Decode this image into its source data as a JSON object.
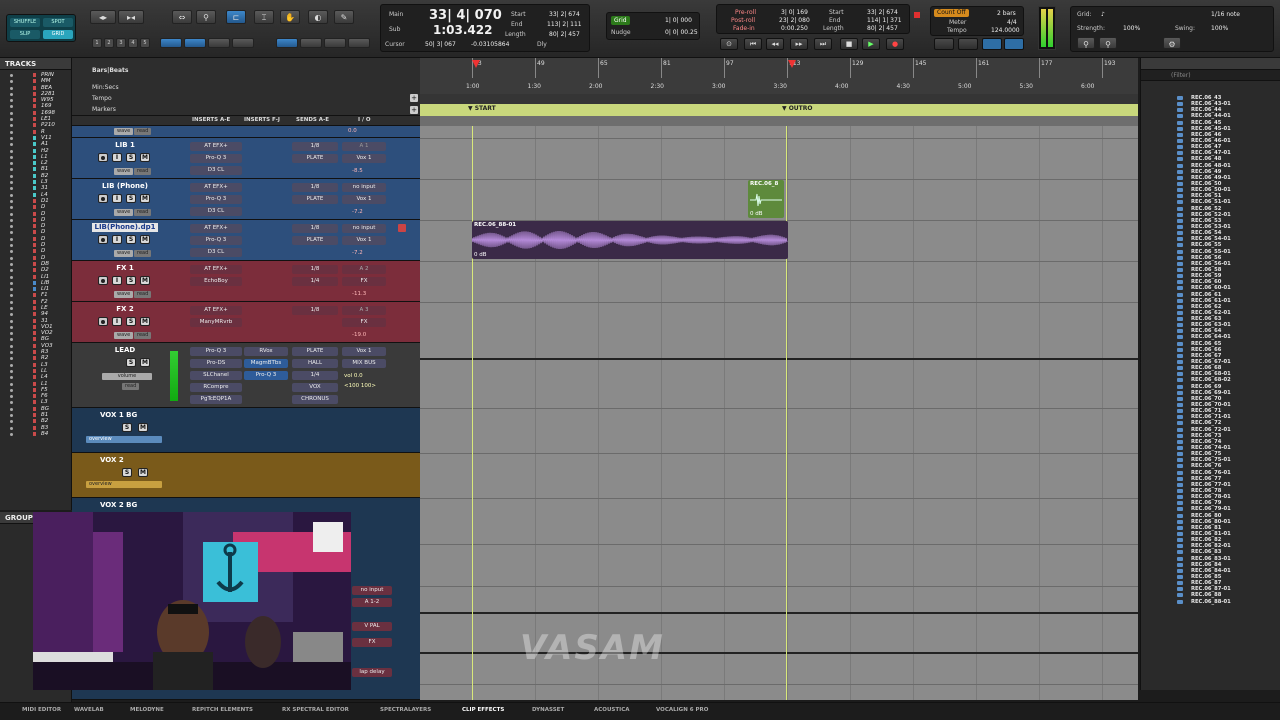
{
  "toolbar": {
    "modes": [
      "SHUFFLE",
      "SPOT",
      "SLIP",
      "GRID"
    ],
    "zoom_presets": [
      "1",
      "2",
      "3",
      "4",
      "5"
    ],
    "counter": {
      "main_label": "Main",
      "main_value": "33| 4| 070",
      "sub_label": "Sub",
      "sub_value": "1:03.422",
      "cursor_label": "Cursor",
      "cursor_value": "50| 3| 067",
      "cursor_value2": "-0.03105864",
      "start_label": "Start",
      "end_label": "End",
      "length_label": "Length",
      "start_value": "33| 2| 674",
      "end_value": "113| 2| 111",
      "length_value": "80| 2| 457",
      "dly_label": "Dly"
    },
    "grid": {
      "label": "Grid",
      "value": "1| 0| 000",
      "nudge_label": "Nudge",
      "nudge_value": "0| 0| 00.25"
    },
    "preroll": {
      "preroll_label": "Pre-roll",
      "postroll_label": "Post-roll",
      "fadein_label": "Fade-in",
      "preroll_value": "3| 0| 169",
      "postroll_value": "23| 2| 080",
      "fadein_value": "0:00.250",
      "start_label": "Start",
      "end_label": "End",
      "length_label": "Length",
      "start_value": "33| 2| 674",
      "end_value": "114| 1| 371",
      "length_value": "80| 2| 457"
    },
    "countoff": {
      "label": "Count Off",
      "bars": "2 bars",
      "meter_label": "Meter",
      "meter_value": "4/4",
      "tempo_label": "Tempo",
      "tempo_value": "124.0000"
    },
    "grid_panel": {
      "grid_label": "Grid:",
      "grid_value": "1/16 note",
      "strength_label": "Strength:",
      "strength_value": "100%",
      "swing_label": "Swing:",
      "swing_value": "100%"
    }
  },
  "tracks_panel": {
    "title": "TRACKS",
    "items": [
      {
        "name": "PRIN",
        "color": "#c94a4a"
      },
      {
        "name": "MM",
        "color": "#c94a4a"
      },
      {
        "name": "BEA",
        "color": "#c94a4a"
      },
      {
        "name": "2281",
        "color": "#c94a4a"
      },
      {
        "name": "W95",
        "color": "#c94a4a"
      },
      {
        "name": "169",
        "color": "#c94a4a"
      },
      {
        "name": "1698",
        "color": "#c94a4a"
      },
      {
        "name": "LE1",
        "color": "#c94a4a"
      },
      {
        "name": "P210",
        "color": "#c94a4a"
      },
      {
        "name": "R",
        "color": "#c94a4a"
      },
      {
        "name": "V11",
        "color": "#4ac9c9"
      },
      {
        "name": "A1",
        "color": "#4ac9c9"
      },
      {
        "name": "H2",
        "color": "#4ac9c9"
      },
      {
        "name": "L1",
        "color": "#4ac9c9"
      },
      {
        "name": "L2",
        "color": "#4ac9c9"
      },
      {
        "name": "B1",
        "color": "#4ac9c9"
      },
      {
        "name": "B2",
        "color": "#4ac9c9"
      },
      {
        "name": "L3",
        "color": "#4ac9c9"
      },
      {
        "name": "31",
        "color": "#4ac9c9"
      },
      {
        "name": "L4",
        "color": "#4ac9c9"
      },
      {
        "name": "D1",
        "color": "#c94a4a"
      },
      {
        "name": "D",
        "color": "#c94a4a"
      },
      {
        "name": "D",
        "color": "#c94a4a"
      },
      {
        "name": "D",
        "color": "#c94a4a"
      },
      {
        "name": "D",
        "color": "#c94a4a"
      },
      {
        "name": "D",
        "color": "#c94a4a"
      },
      {
        "name": "D",
        "color": "#c94a4a"
      },
      {
        "name": "D",
        "color": "#c94a4a"
      },
      {
        "name": "D",
        "color": "#c94a4a"
      },
      {
        "name": "D",
        "color": "#c94a4a"
      },
      {
        "name": "DB",
        "color": "#c94a4a"
      },
      {
        "name": "D2",
        "color": "#c94a4a"
      },
      {
        "name": "LI1",
        "color": "#c94a4a"
      },
      {
        "name": "LIB",
        "color": "#4a8ac9"
      },
      {
        "name": "LI1",
        "color": "#4a8ac9"
      },
      {
        "name": "F1",
        "color": "#c94a4a"
      },
      {
        "name": "F2",
        "color": "#c94a4a"
      },
      {
        "name": "LE",
        "color": "#c94a4a"
      },
      {
        "name": "94",
        "color": "#c94a4a"
      },
      {
        "name": "31",
        "color": "#c94a4a"
      },
      {
        "name": "VO1",
        "color": "#c94a4a"
      },
      {
        "name": "VO2",
        "color": "#c94a4a"
      },
      {
        "name": "BG",
        "color": "#c94a4a"
      },
      {
        "name": "VO3",
        "color": "#c94a4a"
      },
      {
        "name": "R3",
        "color": "#c94a4a"
      },
      {
        "name": "R2",
        "color": "#c94a4a"
      },
      {
        "name": "L3",
        "color": "#c94a4a"
      },
      {
        "name": "LL",
        "color": "#c94a4a"
      },
      {
        "name": "L4",
        "color": "#c94a4a"
      },
      {
        "name": "L1",
        "color": "#c94a4a"
      },
      {
        "name": "F5",
        "color": "#c94a4a"
      },
      {
        "name": "F6",
        "color": "#c94a4a"
      },
      {
        "name": "L3",
        "color": "#c94a4a"
      },
      {
        "name": "BG",
        "color": "#c94a4a"
      },
      {
        "name": "B1",
        "color": "#c94a4a"
      },
      {
        "name": "B2",
        "color": "#c94a4a"
      },
      {
        "name": "B3",
        "color": "#c94a4a"
      },
      {
        "name": "B4",
        "color": "#c94a4a"
      }
    ]
  },
  "group_panel": {
    "title": "GROUP"
  },
  "rulers": {
    "labels": [
      "Bars|Beats",
      "Min:Secs",
      "Tempo",
      "Markers"
    ],
    "bars": [
      "33",
      "49",
      "65",
      "81",
      "97",
      "113",
      "129",
      "145",
      "161",
      "177",
      "193"
    ],
    "times": [
      "1:00",
      "1:30",
      "2:00",
      "2:30",
      "3:00",
      "3:30",
      "4:00",
      "4:30",
      "5:00",
      "5:30",
      "6:00"
    ],
    "markers": [
      {
        "name": "START"
      },
      {
        "name": "OUTRO"
      }
    ]
  },
  "columns": {
    "inserts_ae": "INSERTS A-E",
    "inserts_fj": "INSERTS F-J",
    "sends_ae": "SENDS A-E",
    "io": "I / O"
  },
  "tracks": [
    {
      "name": "",
      "view": "wave",
      "view2": "read",
      "insert1": "",
      "send_vol": "0.0",
      "io_in": "",
      "io_out": "",
      "vol": "",
      "color": "#2d4f7c"
    },
    {
      "name": "LIB 1",
      "view": "wave",
      "view2": "read",
      "inserts": [
        "AT EFX+",
        "Pro-Q 3",
        "D3 CL"
      ],
      "sends": [
        "1/8",
        "PLATE",
        ""
      ],
      "io": [
        "A 1",
        "Vox 1",
        "-8.5"
      ],
      "color": "#2d4f7c"
    },
    {
      "name": "LIB (Phone)",
      "view": "wave",
      "view2": "read",
      "inserts": [
        "AT EFX+",
        "Pro-Q 3",
        "D3 CL"
      ],
      "sends": [
        "1/8",
        "PLATE",
        ""
      ],
      "io": [
        "no input",
        "Vox 1",
        "-7.2"
      ],
      "color": "#2d4f7c"
    },
    {
      "name": "LIB(Phone).dp1",
      "view": "wave",
      "view2": "read",
      "inserts": [
        "AT EFX+",
        "Pro-Q 3",
        "D3 CL"
      ],
      "sends": [
        "1/8",
        "PLATE",
        ""
      ],
      "io": [
        "no input",
        "Vox 1",
        "-7.2"
      ],
      "color": "#2d4f7c"
    },
    {
      "name": "FX 1",
      "view": "wave",
      "view2": "read",
      "inserts": [
        "AT EFX+",
        "EchoBoy",
        ""
      ],
      "sends": [
        "1/8",
        "1/4",
        ""
      ],
      "io": [
        "A 2",
        "FX",
        "-11.3"
      ],
      "color": "#7c2d3b"
    },
    {
      "name": "FX 2",
      "view": "wave",
      "view2": "read",
      "inserts": [
        "AT EFX+",
        "ManyMRvrb",
        ""
      ],
      "sends": [
        "1/8",
        "",
        ""
      ],
      "io": [
        "A 3",
        "FX",
        "-19.0"
      ],
      "color": "#7c2d3b"
    },
    {
      "name": "LEAD",
      "view": "volume",
      "view2": "read",
      "inserts": [
        "Pro-Q 3",
        "Pro-DS",
        "SLChanel",
        "RCompre",
        "PgTcEQP1A"
      ],
      "inserts_fj": [
        "RVox",
        "MagmBTbs",
        "Pro-Q 3"
      ],
      "sends": [
        "PLATE",
        "HALL",
        "1/4",
        "VOX",
        "CHRONUS"
      ],
      "io": [
        "Vox 1",
        "MIX BUS",
        "vol 0.0",
        "<100 100>"
      ],
      "color": "#3a3a3a"
    }
  ],
  "folder_tracks": [
    {
      "name": "VOX 1 BG",
      "view": "overview",
      "color": "#1e3752"
    },
    {
      "name": "VOX 2",
      "view": "overview",
      "color": "#7a5a1a"
    },
    {
      "name": "VOX 2 BG",
      "view": "",
      "color": "#1e3752"
    }
  ],
  "partial_io": [
    "no input",
    "A 1-2",
    "V PAL",
    "FX",
    "lap delay"
  ],
  "clips": [
    {
      "name": "REC.06_88-01",
      "gain": "0 dB"
    },
    {
      "name": "REC.06_8",
      "gain": "0 dB"
    }
  ],
  "clips_panel": {
    "filter_placeholder": "(Filter)",
    "items": [
      "REC.06_43",
      "REC.06_43-01",
      "REC.06_44",
      "REC.06_44-01",
      "REC.06_45",
      "REC.06_45-01",
      "REC.06_46",
      "REC.06_46-01",
      "REC.06_47",
      "REC.06_47-01",
      "REC.06_48",
      "REC.06_48-01",
      "REC.06_49",
      "REC.06_49-01",
      "REC.06_50",
      "REC.06_50-01",
      "REC.06_51",
      "REC.06_51-01",
      "REC.06_52",
      "REC.06_52-01",
      "REC.06_53",
      "REC.06_53-01",
      "REC.06_54",
      "REC.06_54-01",
      "REC.06_55",
      "REC.06_55-01",
      "REC.06_56",
      "REC.06_56-01",
      "REC.06_58",
      "REC.06_59",
      "REC.06_60",
      "REC.06_60-01",
      "REC.06_61",
      "REC.06_61-01",
      "REC.06_62",
      "REC.06_62-01",
      "REC.06_63",
      "REC.06_63-01",
      "REC.06_64",
      "REC.06_64-01",
      "REC.06_65",
      "REC.06_66",
      "REC.06_67",
      "REC.06_67-01",
      "REC.06_68",
      "REC.06_68-01",
      "REC.06_68-02",
      "REC.06_69",
      "REC.06_69-01",
      "REC.06_70",
      "REC.06_70-01",
      "REC.06_71",
      "REC.06_71-01",
      "REC.06_72",
      "REC.06_72-01",
      "REC.06_73",
      "REC.06_74",
      "REC.06_74-01",
      "REC.06_75",
      "REC.06_75-01",
      "REC.06_76",
      "REC.06_76-01",
      "REC.06_77",
      "REC.06_77-01",
      "REC.06_78",
      "REC.06_78-01",
      "REC.06_79",
      "REC.06_79-01",
      "REC.06_80",
      "REC.06_80-01",
      "REC.06_81",
      "REC.06_81-01",
      "REC.06_82",
      "REC.06_82-01",
      "REC.06_83",
      "REC.06_83-01",
      "REC.06_84",
      "REC.06_84-01",
      "REC.06_85",
      "REC.06_87",
      "REC.06_87-01",
      "REC.06_88",
      "REC.06_88-01"
    ]
  },
  "bottom_tabs": [
    "MIDI EDITOR",
    "WAVELAB",
    "MELODYNE",
    "REPITCH ELEMENTS",
    "RX SPECTRAL EDITOR",
    "SPECTRALAYERS",
    "CLIP EFFECTS",
    "DYNASSET",
    "ACOUSTICA",
    "VOCALIGN 6 PRO"
  ],
  "active_tab": "CLIP EFFECTS",
  "watermark": "VASAM",
  "colors": {
    "accent_blue": "#2aa5bd",
    "marker_bar": "#c9d87c",
    "clip_purple": "#3b2a48",
    "clip_green": "#5e8a3c",
    "fx_red": "#7c2d3b"
  }
}
